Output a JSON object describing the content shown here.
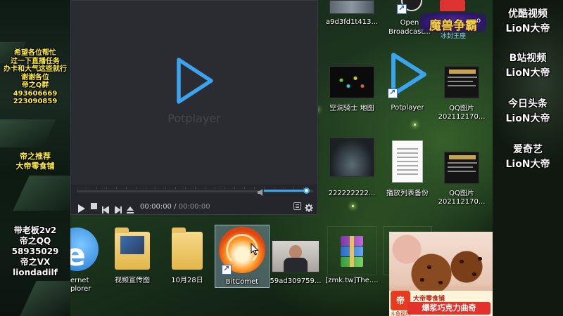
{
  "left_panel": {
    "notice_lines": [
      "希望各位帮忙",
      "过一下直播任务",
      "办卡和大气这些就行",
      "谢谢各位",
      "帝之Q群",
      "493606669",
      "223090859"
    ],
    "recommend_lines": [
      "帝之推荐",
      "大帝零食铺"
    ],
    "contact_lines": [
      "带老板2v2",
      "帝之QQ",
      "58935029",
      "帝之VX",
      "liondadilf"
    ]
  },
  "right_panel": {
    "platforms": [
      {
        "name": "优酷视频",
        "handle": "LioN大帝"
      },
      {
        "name": "B站视频",
        "handle": "LioN大帝"
      },
      {
        "name": "今日头条",
        "handle": "LioN大帝"
      },
      {
        "name": "爱奇艺",
        "handle": "LioN大帝"
      }
    ]
  },
  "player": {
    "brand": "Potplayer",
    "time_current": "00:00:00",
    "time_separator": "/",
    "time_total": "00:00:00",
    "volume_fraction": 0.9,
    "accent_color": "#3aa4ef"
  },
  "desktop": {
    "icons": {
      "top_thumb1": "a9d3fd1t413...",
      "open_broadcast": "Open Broadcast...",
      "warcraft_partial": "o",
      "hollow_knight": "空洞骑士 地图",
      "potplayer": "Potplayer",
      "qq_image_1_line1": "QQ图片",
      "qq_image_1_line2": "202112170...",
      "num_file": "222222222...",
      "playlist_backup": "播放列表备份",
      "qq_image_2_line1": "QQ图片",
      "qq_image_2_line2": "202112170...",
      "ie_line1": "ernet",
      "ie_line2": "plorer",
      "promo_folder": "视频宣传图",
      "oct_folder": "10月28日",
      "bitcomet": "BitComet",
      "video_thumb": "59ad309759...",
      "winrar": "[zmk.tw]The...."
    },
    "warcraft_banner": "魔兽争霸",
    "warcraft_sub": "冰封王座"
  },
  "ad": {
    "logo_text": "帝",
    "brand": "大帝零食铺",
    "sub": "斗鱼福利",
    "slogan": "爆浆巧克力曲奇"
  }
}
